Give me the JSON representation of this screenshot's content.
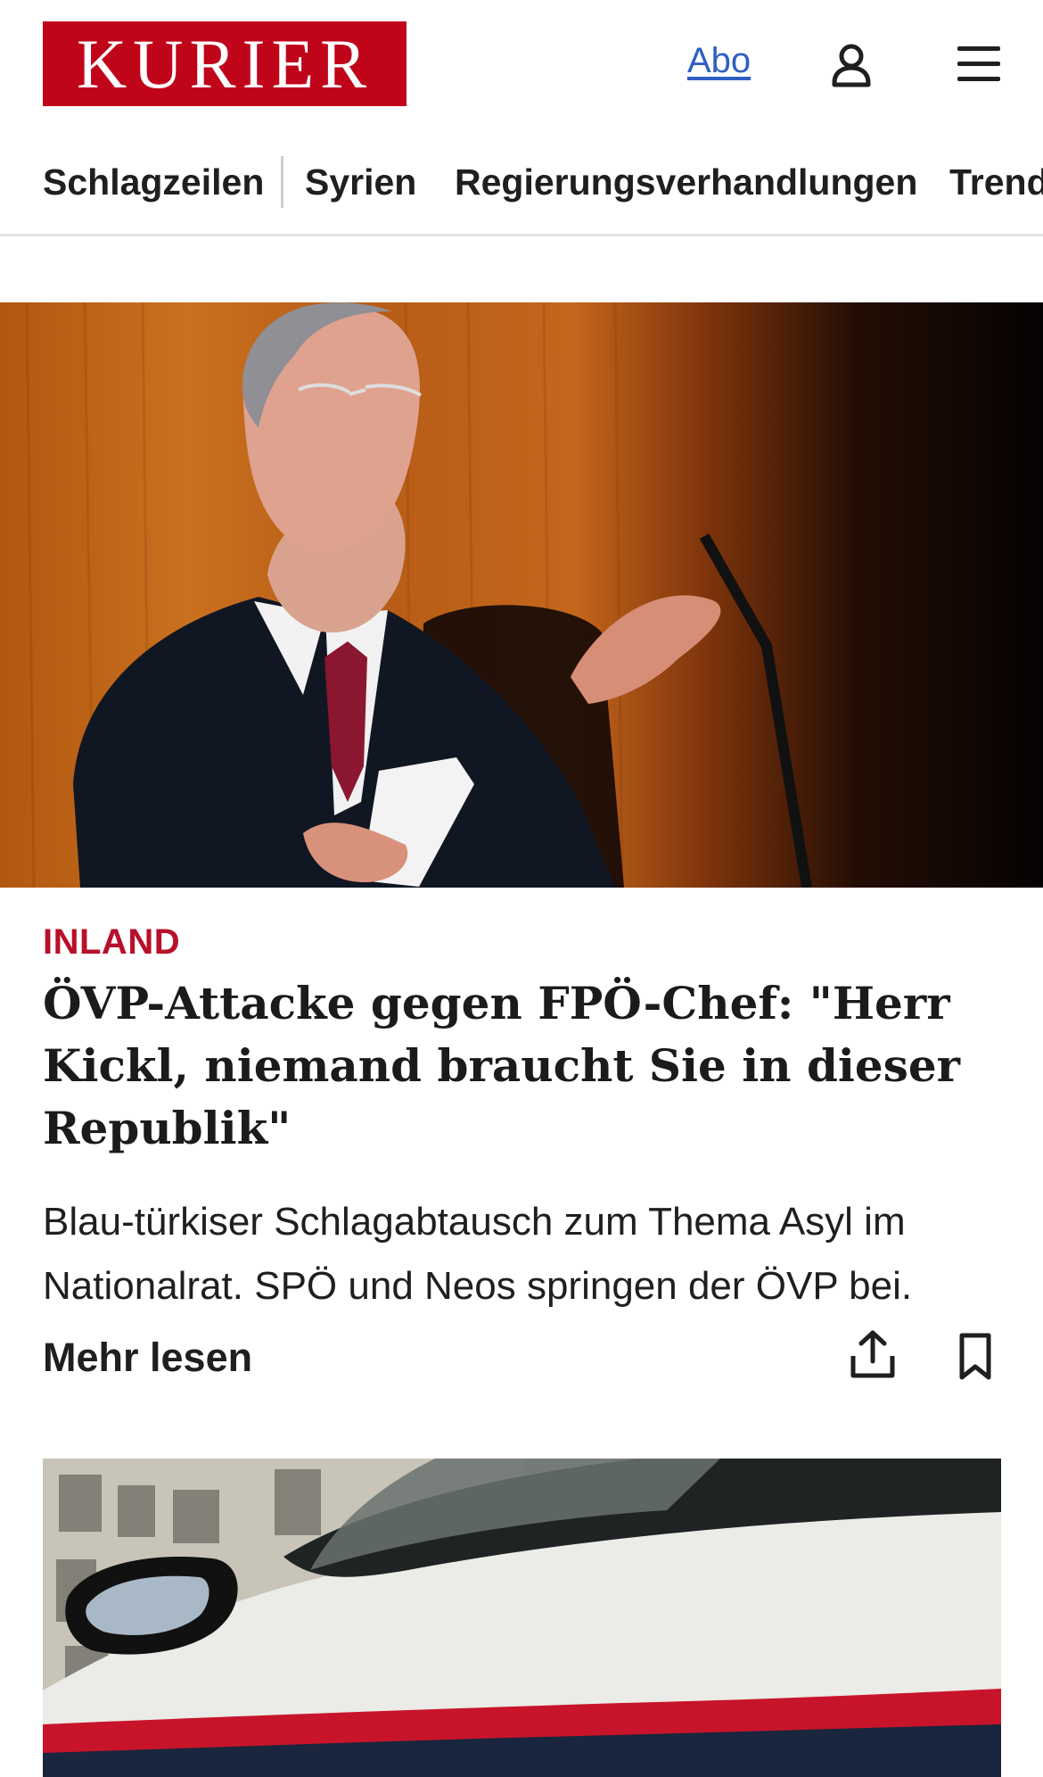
{
  "header": {
    "logo_text": "KURIER",
    "abo_link": "Abo",
    "user_icon": "user-icon",
    "menu_icon": "hamburger-menu-icon",
    "brand_color": "#c0051b",
    "link_color": "#2f5fc4"
  },
  "nav": {
    "items": [
      {
        "label": "Schlagzeilen"
      },
      {
        "label": "Syrien"
      },
      {
        "label": "Regierungsverhandlungen"
      },
      {
        "label": "Trend"
      }
    ]
  },
  "article1": {
    "category": "INLAND",
    "category_color": "#b8102a",
    "headline": "ÖVP-Attacke gegen FPÖ-Chef: \"Herr Kickl, niemand braucht Sie in dieser Republik\"",
    "lead": "Blau-türkiser Schlagabtausch zum Thema Asyl im Nationalrat. SPÖ und Neos springen der ÖVP bei.",
    "more_label": "Mehr lesen",
    "share_icon": "share-icon",
    "bookmark_icon": "bookmark-icon"
  }
}
